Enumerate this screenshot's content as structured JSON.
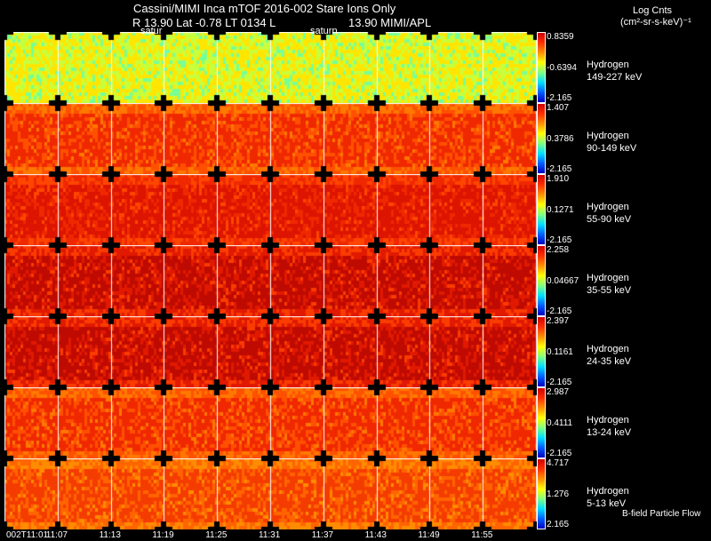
{
  "header": {
    "title": "Cassini/MIMI Inca mTOF  2016-002    Stare    Ions Only",
    "subtitle_left": "R          13.90 Lat -0.78 LT 0134 L",
    "subtitle_right": "13.90  MIMI/APL",
    "marker_1": "satur",
    "marker_2": "saturn",
    "units_line1": "Log Cnts",
    "units_line2": "(cm²-sr-s-keV)⁻¹"
  },
  "chart_data": {
    "type": "heatmap",
    "title": "Cassini/MIMI Inca mTOF  2016-002    Stare    Ions Only",
    "x_tick_labels": [
      "002T11:01",
      "11:07",
      "11:13",
      "11:19",
      "11:25",
      "11:31",
      "11:37",
      "11:43",
      "11:49",
      "11:55"
    ],
    "colormap": "jet",
    "panels": [
      {
        "species": "Hydrogen",
        "energy": "149-227 keV",
        "cmax": "0.8359",
        "cmid": "-0.6394",
        "cmin": "-2.165",
        "tone": "yellow-green"
      },
      {
        "species": "Hydrogen",
        "energy": "90-149 keV",
        "cmax": "1.407",
        "cmid": "0.3786",
        "cmin": "-2.165",
        "tone": "red-orange"
      },
      {
        "species": "Hydrogen",
        "energy": "55-90 keV",
        "cmax": "1.910",
        "cmid": "0.1271",
        "cmin": "-2.165",
        "tone": "red"
      },
      {
        "species": "Hydrogen",
        "energy": "35-55 keV",
        "cmax": "2.258",
        "cmid": "0.04667",
        "cmin": "-2.165",
        "tone": "dark-red"
      },
      {
        "species": "Hydrogen",
        "energy": "24-35 keV",
        "cmax": "2.397",
        "cmid": "0.1161",
        "cmin": "-2.165",
        "tone": "dark-red"
      },
      {
        "species": "Hydrogen",
        "energy": "13-24 keV",
        "cmax": "2.987",
        "cmid": "0.4111",
        "cmin": "-2.165",
        "tone": "red-orange"
      },
      {
        "species": "Hydrogen",
        "energy": "5-13 keV",
        "cmax": "4.717",
        "cmid": "1.276",
        "cmin": "2.165",
        "tone": "orange"
      }
    ],
    "footnote": "B-field Particle Flow"
  }
}
